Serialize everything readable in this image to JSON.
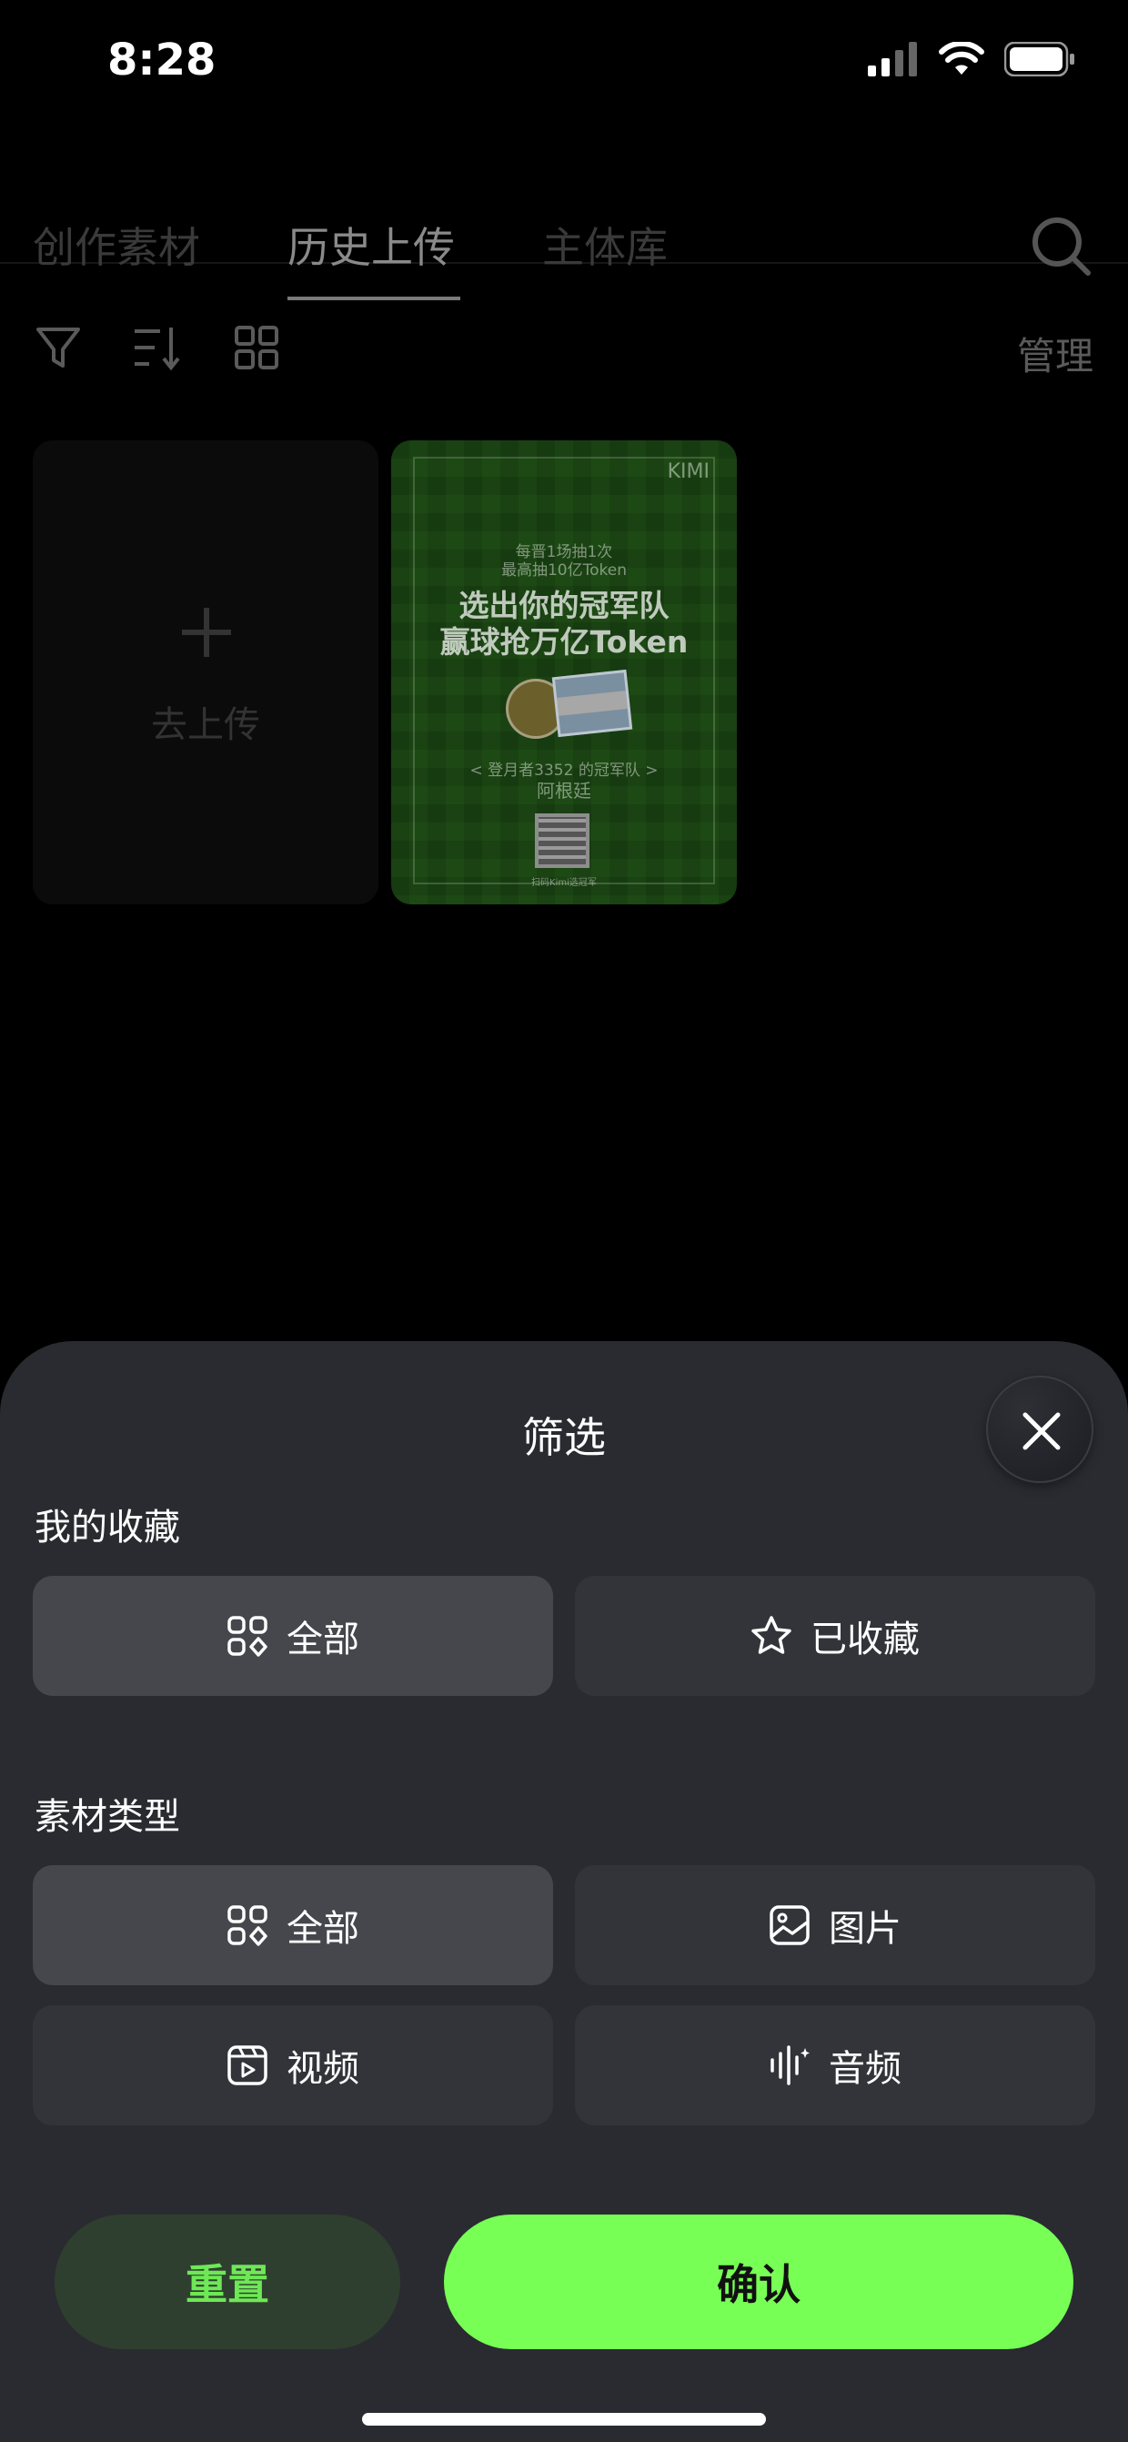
{
  "status_bar": {
    "time": "8:28"
  },
  "tabs": [
    {
      "label": "创作素材",
      "active": false
    },
    {
      "label": "历史上传",
      "active": true
    },
    {
      "label": "主体库",
      "active": false
    }
  ],
  "toolbar": {
    "manage_label": "管理"
  },
  "upload_card": {
    "label": "去上传"
  },
  "poster": {
    "brand": "KIMI",
    "line1": "每晋1场抽1次",
    "line2": "最高抽10亿Token",
    "title1": "选出你的冠军队",
    "title2": "赢球抢万亿Token",
    "team_caption": "< 登月者3352 的冠军队 >",
    "team": "阿根廷",
    "qr_caption": "扫码Kimi选冠军"
  },
  "filter_sheet": {
    "title": "筛选",
    "favorites_section": {
      "label": "我的收藏",
      "options": [
        {
          "label": "全部",
          "icon": "grid-icon",
          "selected": true
        },
        {
          "label": "已收藏",
          "icon": "star-icon",
          "selected": false
        }
      ]
    },
    "type_section": {
      "label": "素材类型",
      "options": [
        {
          "label": "全部",
          "icon": "grid-icon",
          "selected": true
        },
        {
          "label": "图片",
          "icon": "image-icon",
          "selected": false
        },
        {
          "label": "视频",
          "icon": "video-icon",
          "selected": false
        },
        {
          "label": "音频",
          "icon": "audio-icon",
          "selected": false
        }
      ]
    },
    "reset_label": "重置",
    "confirm_label": "确认"
  },
  "colors": {
    "accent": "#77ff55",
    "sheet_bg": "#2a2b30",
    "option_bg": "#333439",
    "option_selected_bg": "#46474d"
  }
}
